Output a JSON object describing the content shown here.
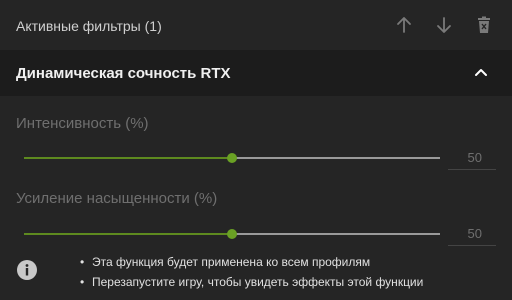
{
  "header": {
    "title": "Активные фильтры (1)",
    "icons": [
      "arrow-up-icon",
      "arrow-down-icon",
      "trash-icon"
    ]
  },
  "filter": {
    "title": "Динамическая сочность RTX",
    "expanded": true
  },
  "sliders": [
    {
      "label": "Интенсивность (%)",
      "value": "50",
      "fraction": 0.5
    },
    {
      "label": "Усиление насыщенности (%)",
      "value": "50",
      "fraction": 0.5
    }
  ],
  "info": {
    "notes": [
      "Эта функция будет применена ко всем профилям",
      "Перезапустите игру, чтобы увидеть эффекты этой функции"
    ]
  },
  "colors": {
    "accent": "#6aa124",
    "track": "#9a9a9a",
    "background": "#252525",
    "bar": "#1c1c1c"
  }
}
